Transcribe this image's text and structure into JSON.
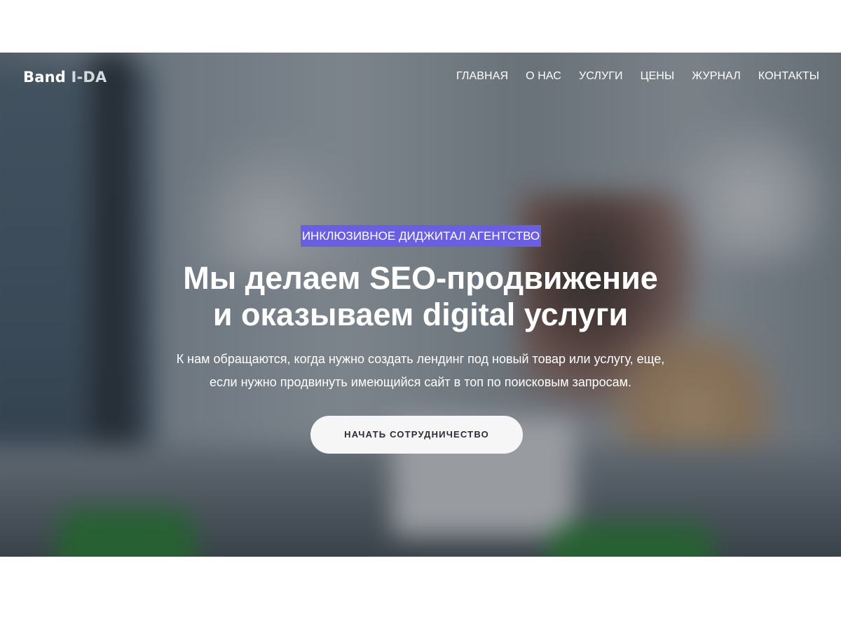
{
  "header": {
    "logo": {
      "main": "Band ",
      "accent": "I-DA"
    },
    "nav": [
      {
        "label": "ГЛАВНАЯ"
      },
      {
        "label": "О НАС"
      },
      {
        "label": "УСЛУГИ"
      },
      {
        "label": "ЦЕНЫ"
      },
      {
        "label": "ЖУРНАЛ"
      },
      {
        "label": "КОНТАКТЫ"
      }
    ]
  },
  "hero": {
    "badge": "ИНКЛЮЗИВНОЕ ДИДЖИТАЛ АГЕНТСТВО",
    "headline": [
      "Мы делаем SEO-продвижение",
      "и оказываем digital услуги"
    ],
    "subtitle": [
      "К нам обращаются, когда нужно создать лендинг под новый товар или услугу, еще,",
      "если нужно продвинуть имеющийся сайт в топ по поисковым запросам."
    ],
    "cta_label": "НАЧАТЬ СОТРУДНИЧЕСТВО"
  },
  "colors": {
    "badge_bg": "#6a5fe0",
    "cta_bg": "#f6f6f7",
    "text": "#ffffff"
  }
}
